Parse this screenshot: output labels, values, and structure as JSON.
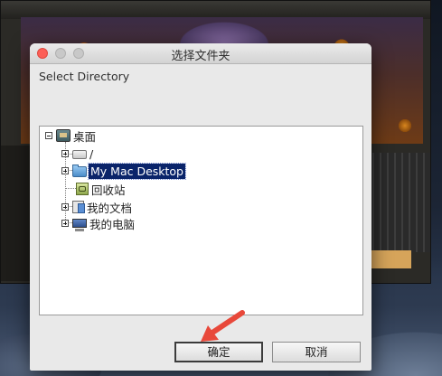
{
  "dialog": {
    "title": "选择文件夹",
    "prompt": "Select Directory",
    "ok_label": "确定",
    "cancel_label": "取消"
  },
  "tree": {
    "root": {
      "label": "桌面",
      "icon": "desktop-icon",
      "expanded": true
    },
    "items": [
      {
        "label": "/",
        "icon": "drive-icon",
        "expander": "plus",
        "selected": false
      },
      {
        "label": "My Mac Desktop",
        "icon": "folder-icon",
        "expander": "plus",
        "selected": true
      },
      {
        "label": "回收站",
        "icon": "recycle-bin-icon",
        "expander": "none",
        "selected": false
      },
      {
        "label": "我的文档",
        "icon": "documents-icon",
        "expander": "plus",
        "selected": false
      },
      {
        "label": "我的电脑",
        "icon": "computer-icon",
        "expander": "plus",
        "selected": false
      }
    ]
  },
  "colors": {
    "selection": "#0a246a",
    "close_button": "#fc5f57",
    "annotation_arrow": "#e8483a"
  }
}
